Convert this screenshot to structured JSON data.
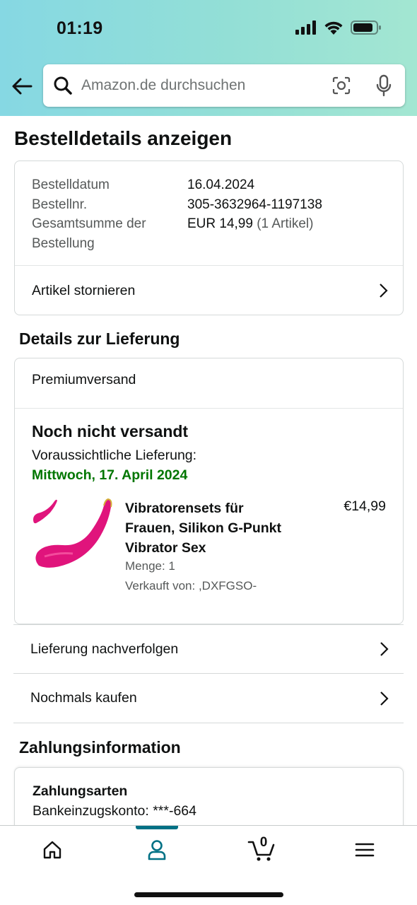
{
  "status_bar": {
    "time": "01:19"
  },
  "search": {
    "placeholder": "Amazon.de durchsuchen"
  },
  "page": {
    "title": "Bestelldetails anzeigen"
  },
  "order_summary": {
    "rows": [
      {
        "label": "Bestelldatum",
        "value": "16.04.2024"
      },
      {
        "label": "Bestellnr.",
        "value": "305-3632964-1197138"
      },
      {
        "label_line1": "Gesamtsumme der",
        "label_line2": "Bestellung",
        "value": "EUR 14,99",
        "value_note": "(1 Artikel)"
      }
    ],
    "cancel_label": "Artikel stornieren"
  },
  "delivery": {
    "section_title": "Details zur Lieferung",
    "shipping_method": "Premiumversand",
    "status": "Noch nicht versandt",
    "eta_label": "Voraussichtliche Lieferung:",
    "eta_date": "Mittwoch, 17. April 2024",
    "eta_color": "#007600",
    "product": {
      "title_line1": "Vibratorensets für",
      "title_line2": "Frauen, Silikon G-Punkt",
      "title_line3": "Vibrator Sex",
      "price": "€14,99",
      "quantity": "Menge: 1",
      "seller": "Verkauft von: ,DXFGSO-",
      "image_color": "#e0147c"
    }
  },
  "actions": {
    "track_label": "Lieferung nachverfolgen",
    "buy_again_label": "Nochmals kaufen"
  },
  "payment": {
    "section_title": "Zahlungsinformation",
    "heading": "Zahlungsarten",
    "detail": "Bankeinzugskonto: ***-664"
  },
  "bottom_nav": {
    "items": [
      "home-icon",
      "account-icon",
      "cart-icon",
      "menu-icon"
    ],
    "active": "account-icon",
    "cart_count": "0",
    "accent_color": "#007185"
  }
}
